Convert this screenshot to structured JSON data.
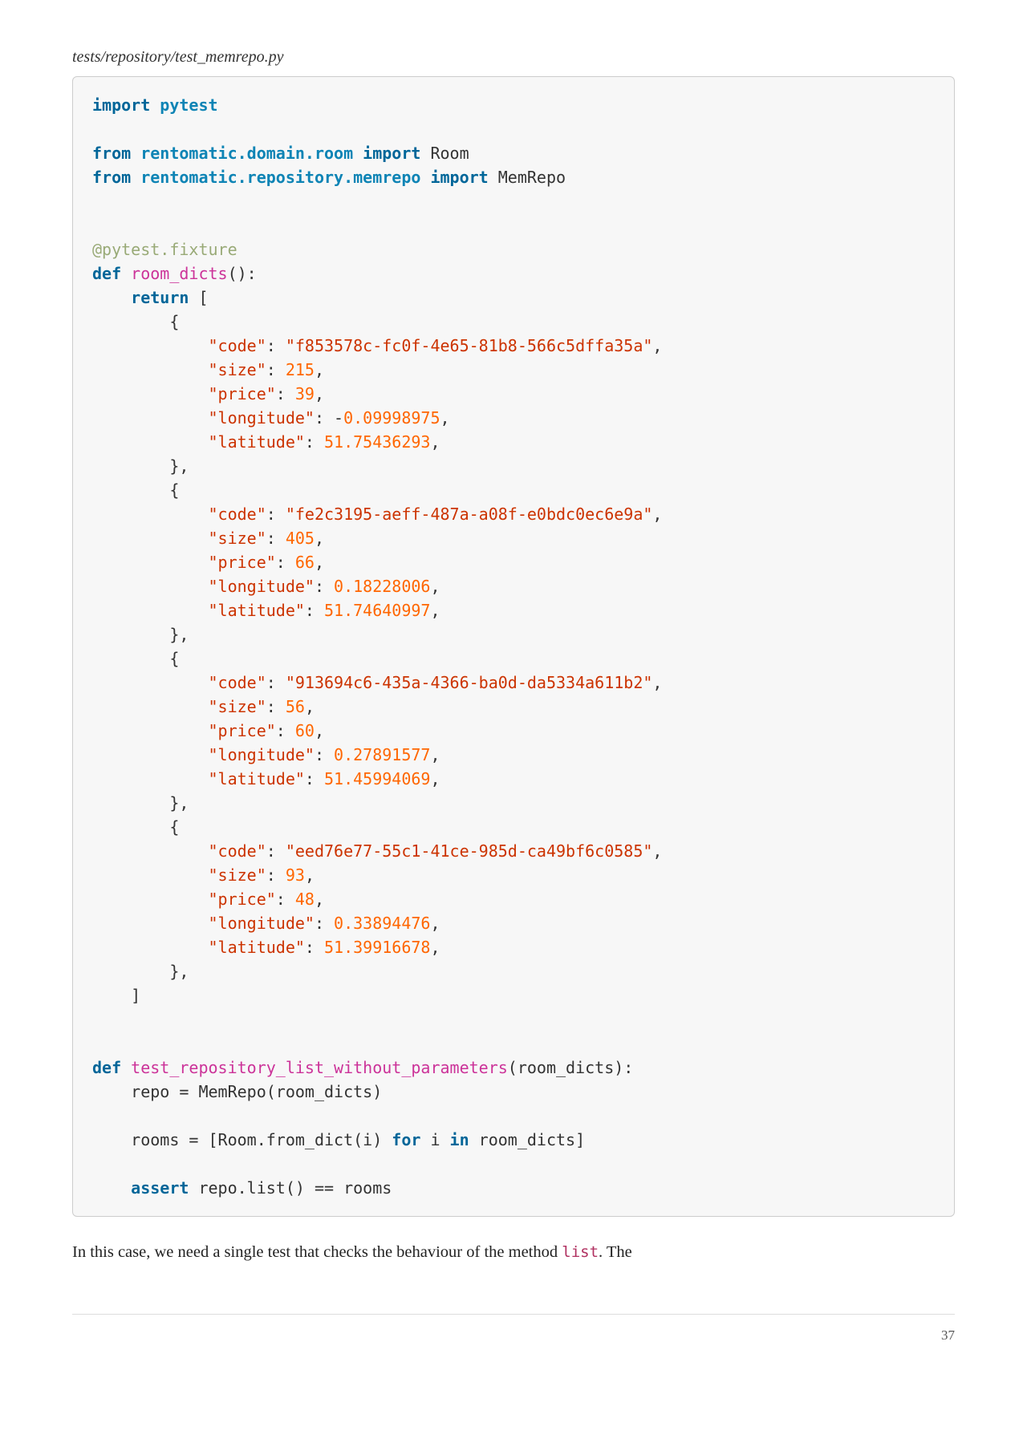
{
  "file_path": "tests/repository/test_memrepo.py",
  "code": {
    "t_import": "import",
    "t_from": "from",
    "t_def": "def",
    "t_return": "return",
    "t_for": "for",
    "t_in": "in",
    "t_assert": "assert",
    "mod_pytest": "pytest",
    "mod_domain": "rentomatic.domain.room",
    "cls_room": "Room",
    "mod_repo": "rentomatic.repository.memrepo",
    "cls_memrepo": "MemRepo",
    "decorator": "@pytest.fixture",
    "fn_room_dicts": "room_dicts",
    "fn_test": "test_repository_list_without_parameters",
    "k_code": "\"code\"",
    "k_size": "\"size\"",
    "k_price": "\"price\"",
    "k_longitude": "\"longitude\"",
    "k_latitude": "\"latitude\"",
    "r0_code": "\"f853578c-fc0f-4e65-81b8-566c5dffa35a\"",
    "r0_size": "215",
    "r0_price": "39",
    "r0_lon_neg": "-",
    "r0_lon": "0.09998975",
    "r0_lat": "51.75436293",
    "r1_code": "\"fe2c3195-aeff-487a-a08f-e0bdc0ec6e9a\"",
    "r1_size": "405",
    "r1_price": "66",
    "r1_lon": "0.18228006",
    "r1_lat": "51.74640997",
    "r2_code": "\"913694c6-435a-4366-ba0d-da5334a611b2\"",
    "r2_size": "56",
    "r2_price": "60",
    "r2_lon": "0.27891577",
    "r2_lat": "51.45994069",
    "r3_code": "\"eed76e77-55c1-41ce-985d-ca49bf6c0585\"",
    "r3_size": "93",
    "r3_price": "48",
    "r3_lon": "0.33894476",
    "r3_lat": "51.39916678",
    "body_repo": "    repo = MemRepo(room_dicts)",
    "body_rooms_p1": "    rooms = [Room.from_dict(i) ",
    "body_rooms_p2": " i ",
    "body_rooms_p3": " room_dicts]",
    "body_assert": " repo.list() == rooms"
  },
  "paragraph": {
    "p1": "In this case, we need a single test that checks the behaviour of the method ",
    "code": "list",
    "p2": ". The"
  },
  "page_number": "37"
}
